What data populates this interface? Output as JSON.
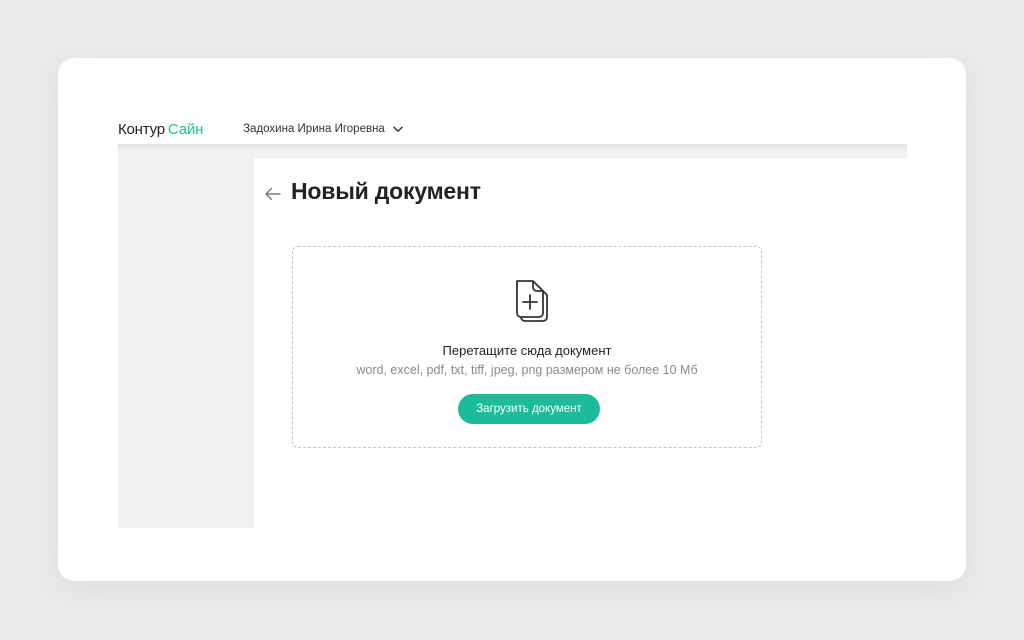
{
  "header": {
    "logo_main": "Контур",
    "logo_accent": "Сайн",
    "user_name": "Задохина Ирина Игоревна"
  },
  "page": {
    "title": "Новый документ"
  },
  "dropzone": {
    "title": "Перетащите сюда документ",
    "hint": "word, excel, pdf, txt, tiff, jpeg, png размером не более 10 Мб",
    "button_label": "Загрузить документ"
  },
  "colors": {
    "accent": "#1cbc9b",
    "background": "#e9eaeb",
    "sidebar": "#f2f2f2"
  },
  "icons": {
    "back": "arrow-left-icon",
    "user_menu": "chevron-down-icon",
    "dropzone": "document-add-icon"
  }
}
